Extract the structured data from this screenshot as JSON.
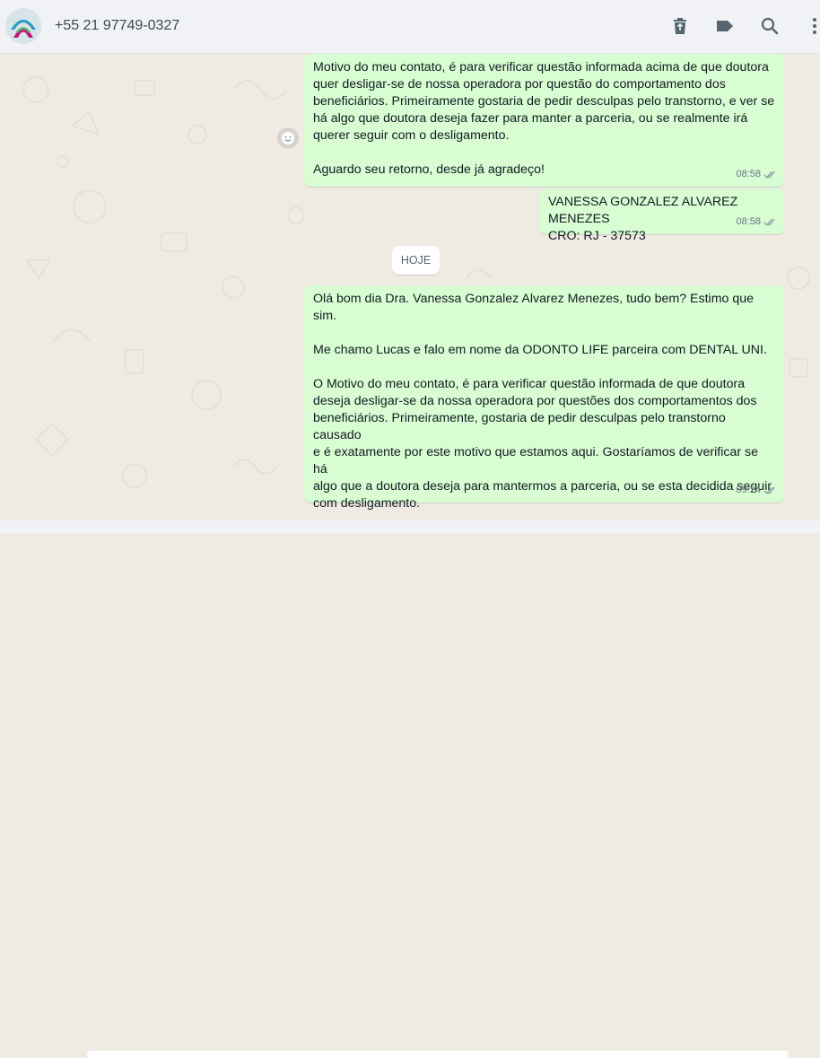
{
  "header": {
    "contact_name": "+55 21 97749-0327",
    "icons": [
      "delete-icon",
      "label-icon",
      "search-icon",
      "menu-icon"
    ]
  },
  "messages": [
    {
      "text": "Motivo do meu contato, é para verificar questão informada acima de que doutora\nquer desligar-se de nossa operadora por questão do comportamento dos\nbeneficiários. Primeiramente gostaria de pedir desculpas pelo transtorno, e ver se\nhá algo que doutora deseja fazer para manter a parceria, ou se realmente irá\nquerer seguir com o desligamento.\n\nAguardo seu retorno, desde já agradeço!",
      "time": "08:58"
    },
    {
      "text": "VANESSA GONZALEZ ALVAREZ MENEZES\nCRO: RJ - 37573",
      "time": "08:58"
    },
    {
      "text": "Olá bom dia Dra. Vanessa Gonzalez Alvarez Menezes, tudo bem? Estimo que sim.\n\nMe chamo Lucas e falo em nome da ODONTO LIFE parceira com DENTAL UNI.\n\nO Motivo do meu contato, é para verificar questão informada de que doutora\ndeseja desligar-se da nossa operadora por questões dos comportamentos dos\nbeneficiários. Primeiramente, gostaria de pedir desculpas pelo transtorno causado\ne é exatamente por este motivo que estamos aqui. Gostaríamos de verificar se há\nalgo que a doutora deseja para mantermos a parceria, ou se esta decidida seguir\ncom desligamento.\n\nAguardo seu retorno, desde já agradeço!",
      "time": "09:24"
    }
  ],
  "day_separator": "HOJE",
  "colors": {
    "outgoing_bubble": "#d9fdd3",
    "chat_background": "#efeae2",
    "header_background": "#f0f2f5"
  }
}
